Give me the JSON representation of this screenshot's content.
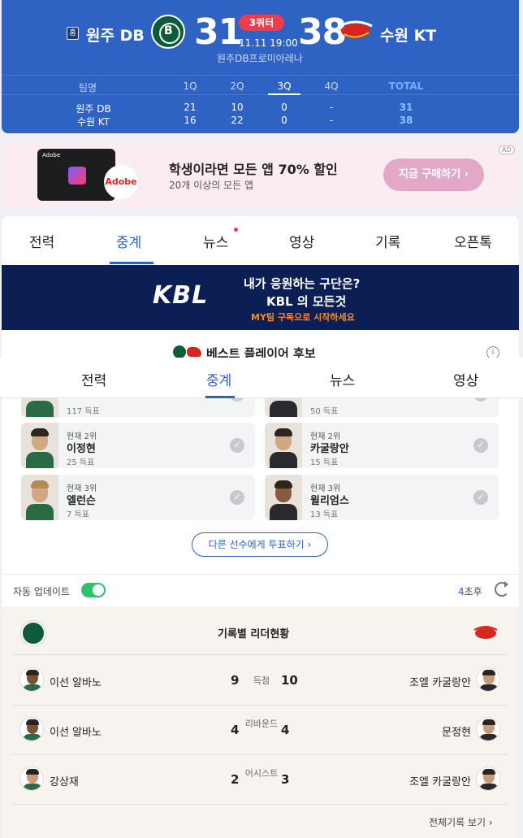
{
  "scoreboard": {
    "home_badge": "홈",
    "home_team": "원주 DB",
    "away_team": "수원 KT",
    "home_score": "31",
    "away_score": "38",
    "quarter": "3쿼터",
    "datetime": "11.11 19:00",
    "arena": "원주DB프로미아레나",
    "headers": {
      "team": "팀명",
      "q1": "1Q",
      "q2": "2Q",
      "q3": "3Q",
      "q4": "4Q",
      "total": "TOTAL"
    },
    "rows": [
      {
        "team": "원주 DB",
        "q1": "21",
        "q2": "10",
        "q3": "0",
        "q4": "-",
        "total": "31"
      },
      {
        "team": "수원 KT",
        "q1": "16",
        "q2": "22",
        "q3": "0",
        "q4": "-",
        "total": "38"
      }
    ]
  },
  "ad": {
    "brand_small": "Adobe",
    "brand_circle": "Adobe",
    "title": "학생이라면 모든 앱 70% 할인",
    "subtitle": "20개 이상의 모든 앱",
    "button": "지금 구매하기 ›",
    "mark": "AD"
  },
  "main_tabs": [
    "전력",
    "중계",
    "뉴스",
    "영상",
    "기록",
    "오픈톡"
  ],
  "kbl_banner": {
    "logo": "KBL",
    "line1": "내가 응원하는 구단은?",
    "line2": "KBL 의 모든것",
    "line3": "MY팀 구독으로 시작하세요"
  },
  "best_player": {
    "title": "베스트 플레이어 후보",
    "info": "i"
  },
  "sticky_tabs": [
    "전력",
    "중계",
    "뉴스",
    "영상"
  ],
  "candidates": {
    "partial": [
      {
        "votes": "117 득표"
      },
      {
        "votes": "50 득표"
      }
    ],
    "cards": [
      {
        "rank": "현재 2위",
        "name": "이정현",
        "votes": "25 득표",
        "team": "db"
      },
      {
        "rank": "현재 2위",
        "name": "카굴랑안",
        "votes": "15 득표",
        "team": "kt"
      },
      {
        "rank": "현재 3위",
        "name": "엘런슨",
        "votes": "7 득표",
        "team": "db"
      },
      {
        "rank": "현재 3위",
        "name": "윌리엄스",
        "votes": "13 득표",
        "team": "kt"
      }
    ],
    "vote_more": "다른 선수에게 투표하기 ›"
  },
  "auto_update": {
    "label": "자동 업데이트",
    "count": "4",
    "suffix": "초후"
  },
  "leaders": {
    "title": "기록별 리더현황",
    "rows": [
      {
        "home_name": "이선 알바노",
        "home_val": "9",
        "category": "득점",
        "away_val": "10",
        "away_name": "조엘 카굴랑안"
      },
      {
        "home_name": "이선 알바노",
        "home_val": "4",
        "category": "리바운드",
        "away_val": "4",
        "away_name": "문정현"
      },
      {
        "home_name": "강상재",
        "home_val": "2",
        "category": "어시스트",
        "away_val": "3",
        "away_name": "조엘 카굴랑안"
      }
    ],
    "all_records": "전체기록 보기 ›"
  },
  "colors": {
    "primary": "#2f63c3",
    "scoreboard_bg": "#2f63c3",
    "live_red": "#ef3c4d",
    "toggle_on": "#2fc26e"
  }
}
